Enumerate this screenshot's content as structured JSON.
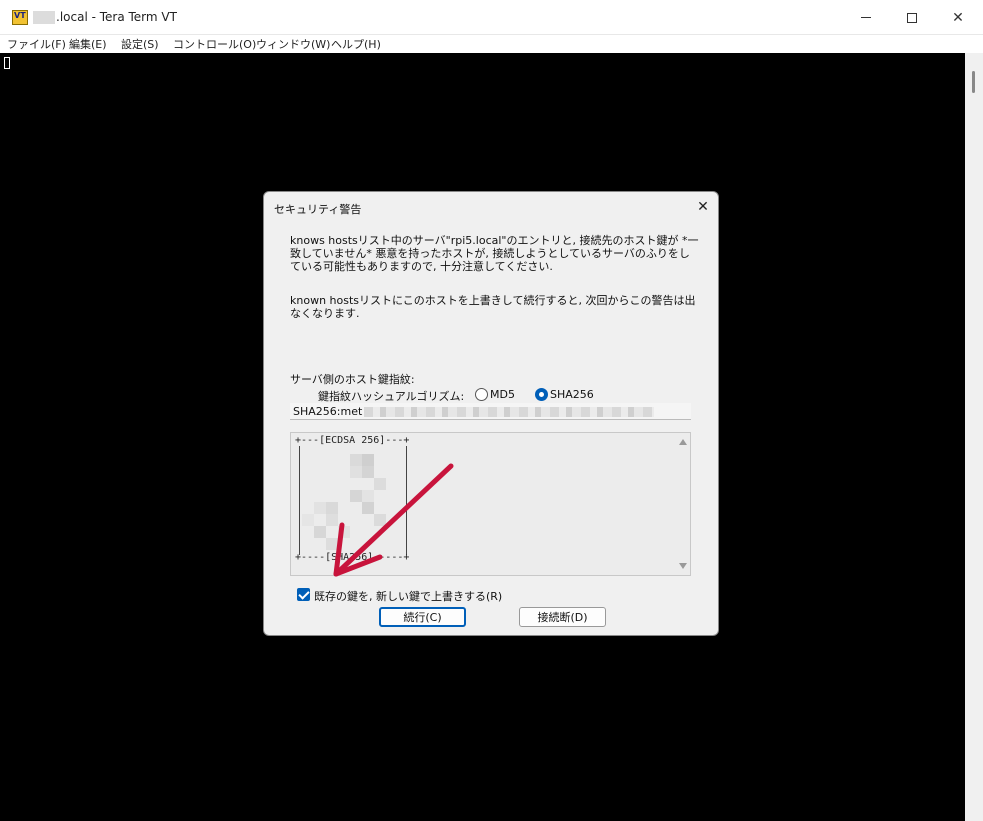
{
  "window": {
    "title": ".local - Tera Term VT",
    "icon": "teraterm-vt-icon",
    "icon_text": "VT",
    "controls": {
      "minimize": "minimize-icon",
      "maximize": "maximize-icon",
      "close": "close-icon"
    }
  },
  "menu": {
    "items": [
      "ファイル(F)",
      "編集(E)",
      "設定(S)",
      "コントロール(O)",
      "ウィンドウ(W)",
      "ヘルプ(H)"
    ]
  },
  "terminal": {
    "background": "#000000"
  },
  "dialog": {
    "title": "セキュリティ警告",
    "close_glyph": "✕",
    "warning_text": "knows hostsリスト中のサーバ\"rpi5.local\"のエントリと, 接続先のホスト鍵が *一致していません* 悪意を持ったホストが, 接続しようとしているサーバのふりをしている可能性もありますので, 十分注意してください.",
    "overwrite_text": "known hostsリストにこのホストを上書きして続行すると, 次回からこの警告は出なくなります.",
    "fingerprint_label": "サーバ側のホスト鍵指紋:",
    "hash_algo_label": "鍵指紋ハッシュアルゴリズム:",
    "hash_options": [
      {
        "label": "MD5",
        "checked": false
      },
      {
        "label": "SHA256",
        "checked": true
      }
    ],
    "fingerprint_value": "SHA256:met",
    "randomart_header": "+---[ECDSA 256]---+",
    "randomart_footer": "+----[SHA256]-----+",
    "replace_checkbox": {
      "label": "既存の鍵を, 新しい鍵で上書きする(R)",
      "checked": true
    },
    "buttons": {
      "continue": "続行(C)",
      "disconnect": "接続断(D)"
    }
  },
  "annotation": {
    "arrow_color": "#c8143c"
  },
  "colors": {
    "accent": "#005fb8",
    "dialog_bg": "#f0f0f0"
  }
}
